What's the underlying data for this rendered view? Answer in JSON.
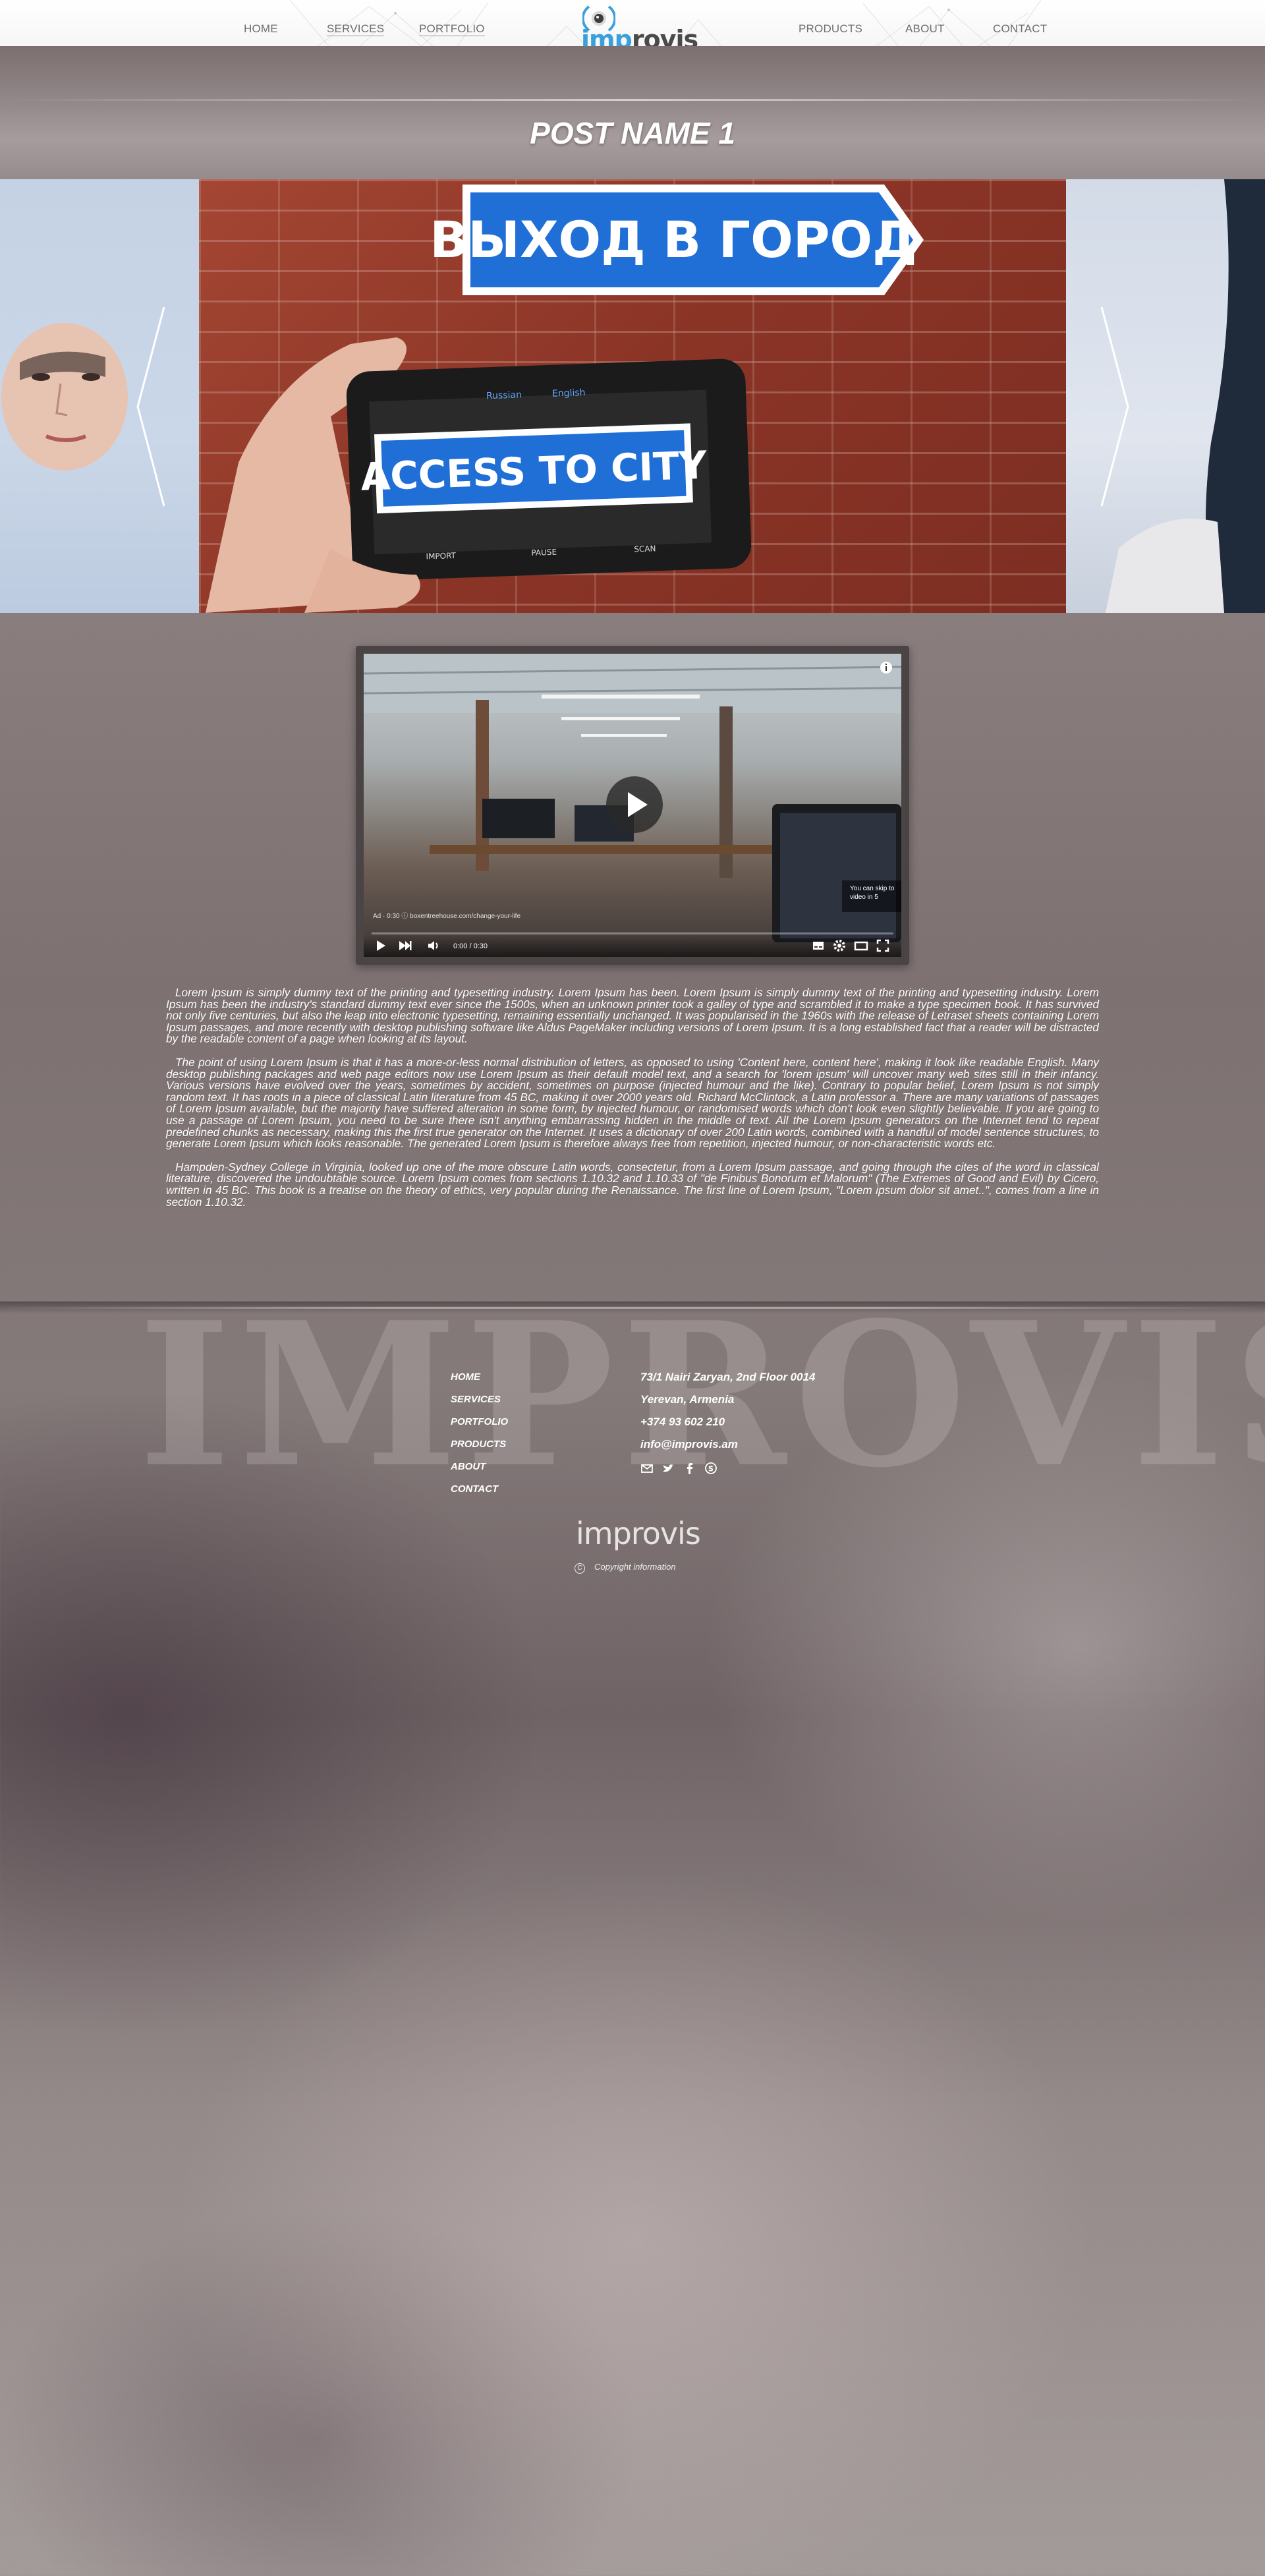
{
  "header": {
    "nav_left": [
      "HOME",
      "SERVICES",
      "PORTFOLIO"
    ],
    "nav_right": [
      "PRODUCTS",
      "ABOUT",
      "CONTACT"
    ],
    "logo": {
      "part1": "imp",
      "part2": "rovis"
    }
  },
  "post": {
    "title": "POST NAME 1"
  },
  "slider": {
    "main_sign_text": "ВЫХОД В ГОРОД",
    "phone_text": "ACCESS TO CITY",
    "phone_lang_from": "Russian",
    "phone_lang_to": "English",
    "phone_buttons": [
      "IMPORT",
      "PAUSE",
      "SCAN"
    ]
  },
  "video": {
    "time": "0:00 / 0:30",
    "ad_text": "Ad · 0:30 ⓘ  boxentreehouse.com/change-your-life",
    "skip_text_1": "You can skip to",
    "skip_text_2": "video in 5",
    "progress": 0.0
  },
  "article": {
    "paragraphs": [
      "Lorem Ipsum is simply dummy text of the printing and typesetting industry. Lorem Ipsum has been. Lorem Ipsum is simply dummy text of the printing and typesetting industry. Lorem Ipsum has been the industry's standard dummy text ever since the 1500s, when an unknown printer took a galley of type and scrambled it to make a type specimen book. It has survived not only five centuries, but also the leap into electronic typesetting, remaining essentially unchanged. It was popularised in the 1960s with the release of Letraset sheets containing Lorem Ipsum passages, and more recently with desktop publishing software like Aldus PageMaker including versions of Lorem Ipsum. It is a long established fact that a reader will be distracted by the readable content of a page when looking at its layout.",
      "The point of using Lorem Ipsum is that it has a more-or-less normal distribution of letters, as opposed to using 'Content here, content here', making it look like readable English. Many desktop publishing packages and web page editors now use Lorem Ipsum as their default model text, and a search for 'lorem ipsum' will uncover many web sites still in their infancy. Various versions have evolved over the years, sometimes by accident, sometimes on purpose (injected humour and the like). Contrary to popular belief, Lorem Ipsum is not simply random text. It has roots in a piece of classical Latin literature from 45 BC, making it over 2000 years old. Richard McClintock, a Latin professor a. There are many variations of passages of Lorem Ipsum available, but the majority have suffered alteration in some form, by injected humour, or randomised words which don't look even slightly believable. If you are going to use a passage of Lorem Ipsum, you need to be sure there isn't anything embarrassing hidden in the middle of text. All the Lorem Ipsum generators on the Internet tend to repeat predefined chunks as necessary, making this the first true generator on the Internet. It uses a dictionary of over 200 Latin words, combined with a handful of model sentence structures, to generate Lorem Ipsum which looks reasonable. The generated Lorem Ipsum is therefore always free from repetition, injected humour, or non-characteristic words etc.",
      "Hampden-Sydney College in Virginia, looked up one of the more obscure Latin words, consectetur, from a Lorem Ipsum passage, and going through the cites of the word in classical literature, discovered the undoubtable source. Lorem Ipsum comes from sections 1.10.32 and 1.10.33 of \"de Finibus Bonorum et Malorum\" (The Extremes of Good and Evil) by Cicero, written in 45 BC. This book is a treatise on the theory of ethics, very popular during the Renaissance. The first line of Lorem Ipsum, \"Lorem ipsum dolor sit amet..\", comes from a line in section 1.10.32."
    ]
  },
  "footer": {
    "watermark": "IMPROVIS",
    "nav": [
      "HOME",
      "SERVICES",
      "PORTFOLIO",
      "PRODUCTS",
      "ABOUT",
      "CONTACT"
    ],
    "address_1": "73/1 Nairi Zaryan, 2nd Floor 0014",
    "address_2": "Yerevan, Armenia",
    "phone": "+374 93 602 210",
    "email": "info@improvis.am",
    "social_icons": [
      "mail-icon",
      "twitter-icon",
      "facebook-icon",
      "skype-icon"
    ],
    "logo_text": "improvis",
    "copyright_symbol": "C",
    "copyright": "Copyright information"
  },
  "colors": {
    "brand_blue": "#3aa0db",
    "logo_dark": "#4a4a4a",
    "sign_blue": "#1f6fd6"
  }
}
